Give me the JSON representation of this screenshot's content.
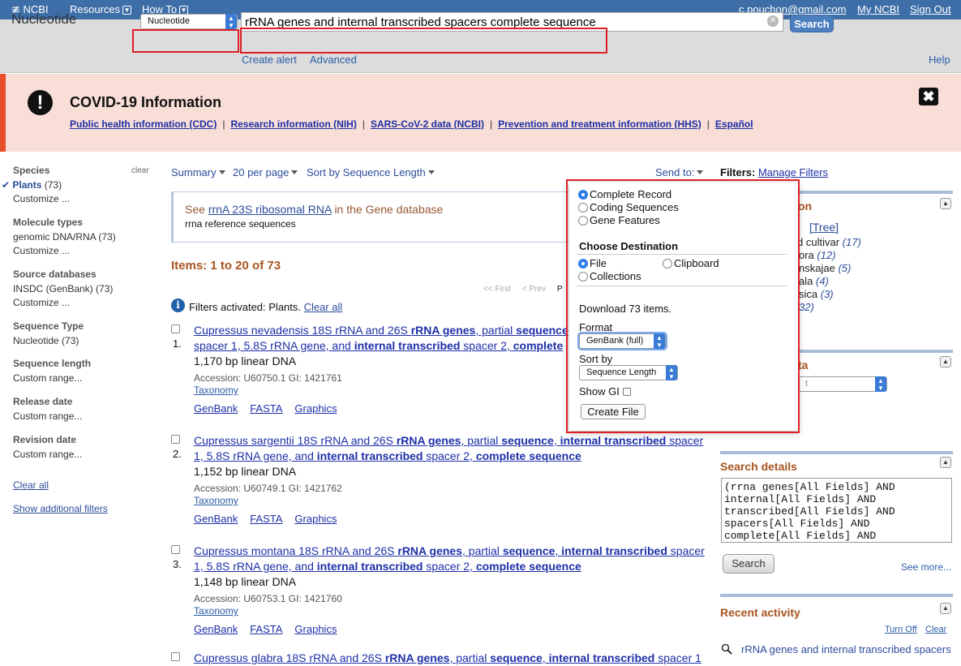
{
  "topnav": {
    "logo": "NCBI",
    "resources": "Resources",
    "howto": "How To",
    "email": "c.pouchon@gmail.com",
    "myncbi": "My NCBI",
    "signout": "Sign Out"
  },
  "search": {
    "db_label": "Nucleotide",
    "db_select": "Nucleotide",
    "query": "rRNA genes and internal transcribed spacers complete sequence",
    "button": "Search",
    "create_alert": "Create alert",
    "advanced": "Advanced",
    "help": "Help"
  },
  "covid": {
    "title": "COVID-19 Information",
    "links": [
      "Public health information (CDC)",
      "Research information (NIH)",
      "SARS-CoV-2 data (NCBI)",
      "Prevention and treatment information (HHS)",
      "Español"
    ]
  },
  "left_filters": {
    "clear": "clear",
    "species": {
      "title": "Species",
      "selected": "Plants",
      "selected_count": "(73)",
      "customize": "Customize ..."
    },
    "molecule": {
      "title": "Molecule types",
      "item": "genomic DNA/RNA (73)",
      "customize": "Customize ..."
    },
    "source": {
      "title": "Source databases",
      "item": "INSDC (GenBank) (73)",
      "customize": "Customize ..."
    },
    "seqtype": {
      "title": "Sequence Type",
      "item": "Nucleotide (73)"
    },
    "seqlen": {
      "title": "Sequence length",
      "item": "Custom range..."
    },
    "release": {
      "title": "Release date",
      "item": "Custom range..."
    },
    "revision": {
      "title": "Revision date",
      "item": "Custom range..."
    },
    "clear_all": "Clear all",
    "show_more": "Show additional filters"
  },
  "toolbar": {
    "summary": "Summary",
    "perpage": "20 per page",
    "sort": "Sort by Sequence Length",
    "sendto": "Send to:"
  },
  "gene_box": {
    "see": "See",
    "gene_link": "rrnA 23S ribosomal RNA",
    "in_db": "in the Gene database",
    "sub": "rrna reference sequences"
  },
  "results": {
    "count": "Items: 1 to 20 of 73",
    "pager_first": "<< First",
    "pager_prev": "< Prev",
    "pager_partial": "P",
    "filters_activated": "Filters activated: Plants.",
    "clear_all": "Clear all",
    "items": [
      {
        "num": "1.",
        "title_l1_html": "Cupressus nevadensis 18S rRNA and 26S <b>rRNA genes</b>, partial <b>sequence</b>",
        "title_l2_html": "spacer 1, 5.8S rRNA gene, and <b>internal transcribed</b> spacer 2, <b>complete</b>",
        "desc": "1,170 bp linear DNA",
        "accession": "Accession: U60750.1    GI: 1421761",
        "taxonomy": "Taxonomy",
        "links": [
          "GenBank",
          "FASTA",
          "Graphics"
        ]
      },
      {
        "num": "2.",
        "title_l1_html": "Cupressus sargentii 18S rRNA and 26S <b>rRNA genes</b>, partial <b>sequence</b>, <b>internal transcribed</b> spacer",
        "title_l2_html": "1, 5.8S rRNA gene, and <b>internal transcribed</b> spacer 2, <b>complete sequence</b>",
        "desc": "1,152 bp linear DNA",
        "accession": "Accession: U60749.1    GI: 1421762",
        "taxonomy": "Taxonomy",
        "links": [
          "GenBank",
          "FASTA",
          "Graphics"
        ]
      },
      {
        "num": "3.",
        "title_l1_html": "Cupressus montana 18S rRNA and 26S <b>rRNA genes</b>, partial <b>sequence</b>, <b>internal transcribed</b> spacer",
        "title_l2_html": "1, 5.8S rRNA gene, and <b>internal transcribed</b> spacer 2, <b>complete sequence</b>",
        "desc": "1,148 bp linear DNA",
        "accession": "Accession: U60753.1    GI: 1421760",
        "taxonomy": "Taxonomy",
        "links": [
          "GenBank",
          "FASTA",
          "Graphics"
        ]
      },
      {
        "num": "",
        "title_l1_html": "Cupressus glabra 18S rRNA and 26S <b>rRNA genes</b>, partial <b>sequence</b>, <b>internal transcribed</b> spacer 1",
        "title_l2_html": "",
        "desc": "",
        "accession": "",
        "taxonomy": "",
        "links": []
      }
    ]
  },
  "sendto_popup": {
    "format_options": [
      "Complete Record",
      "Coding Sequences",
      "Gene Features"
    ],
    "format_selected": 0,
    "destination_title": "Choose Destination",
    "dest_file": "File",
    "dest_clipboard": "Clipboard",
    "dest_collections": "Collections",
    "download_text": "Download 73 items.",
    "format_label": "Format",
    "format_value": "GenBank (full)",
    "sortby_label": "Sort by",
    "sortby_value": "Sequence Length",
    "showgi_label": "Show GI",
    "create_file": "Create File"
  },
  "right_sidebar": {
    "filters_label": "Filters:",
    "manage_filters": "Manage Filters",
    "taxonomy_heading_frag": "on",
    "tree": "[Tree]",
    "frags": [
      {
        "text": "d cultivar",
        "count": "(17)"
      },
      {
        "text": "ora",
        "count": "(12)"
      },
      {
        "text": "nskajae",
        "count": "(5)"
      },
      {
        "text": "ala",
        "count": "(4)"
      },
      {
        "text": "sica",
        "count": "(3)"
      },
      {
        "text": "",
        "count": "32)"
      }
    ],
    "ta_heading_frag": "ta",
    "ta_select_frag": "t",
    "search_details_title": "Search details",
    "search_details_text": "(rrna genes[All Fields] AND\ninternal[All Fields] AND\ntranscribed[All Fields] AND\nspacers[All Fields] AND\ncomplete[All Fields] AND",
    "search_button": "Search",
    "see_more": "See more...",
    "recent_title": "Recent activity",
    "turn_off": "Turn Off",
    "clear": "Clear",
    "recent_query": "rRNA genes and internal transcribed spacers"
  },
  "colors": {
    "nav_blue": "#3e6ea8",
    "link_blue": "#1d2fa8",
    "heading_orange": "#a8541f",
    "highlight_red": "#e01e26",
    "covid_bg": "#f8ded6"
  }
}
